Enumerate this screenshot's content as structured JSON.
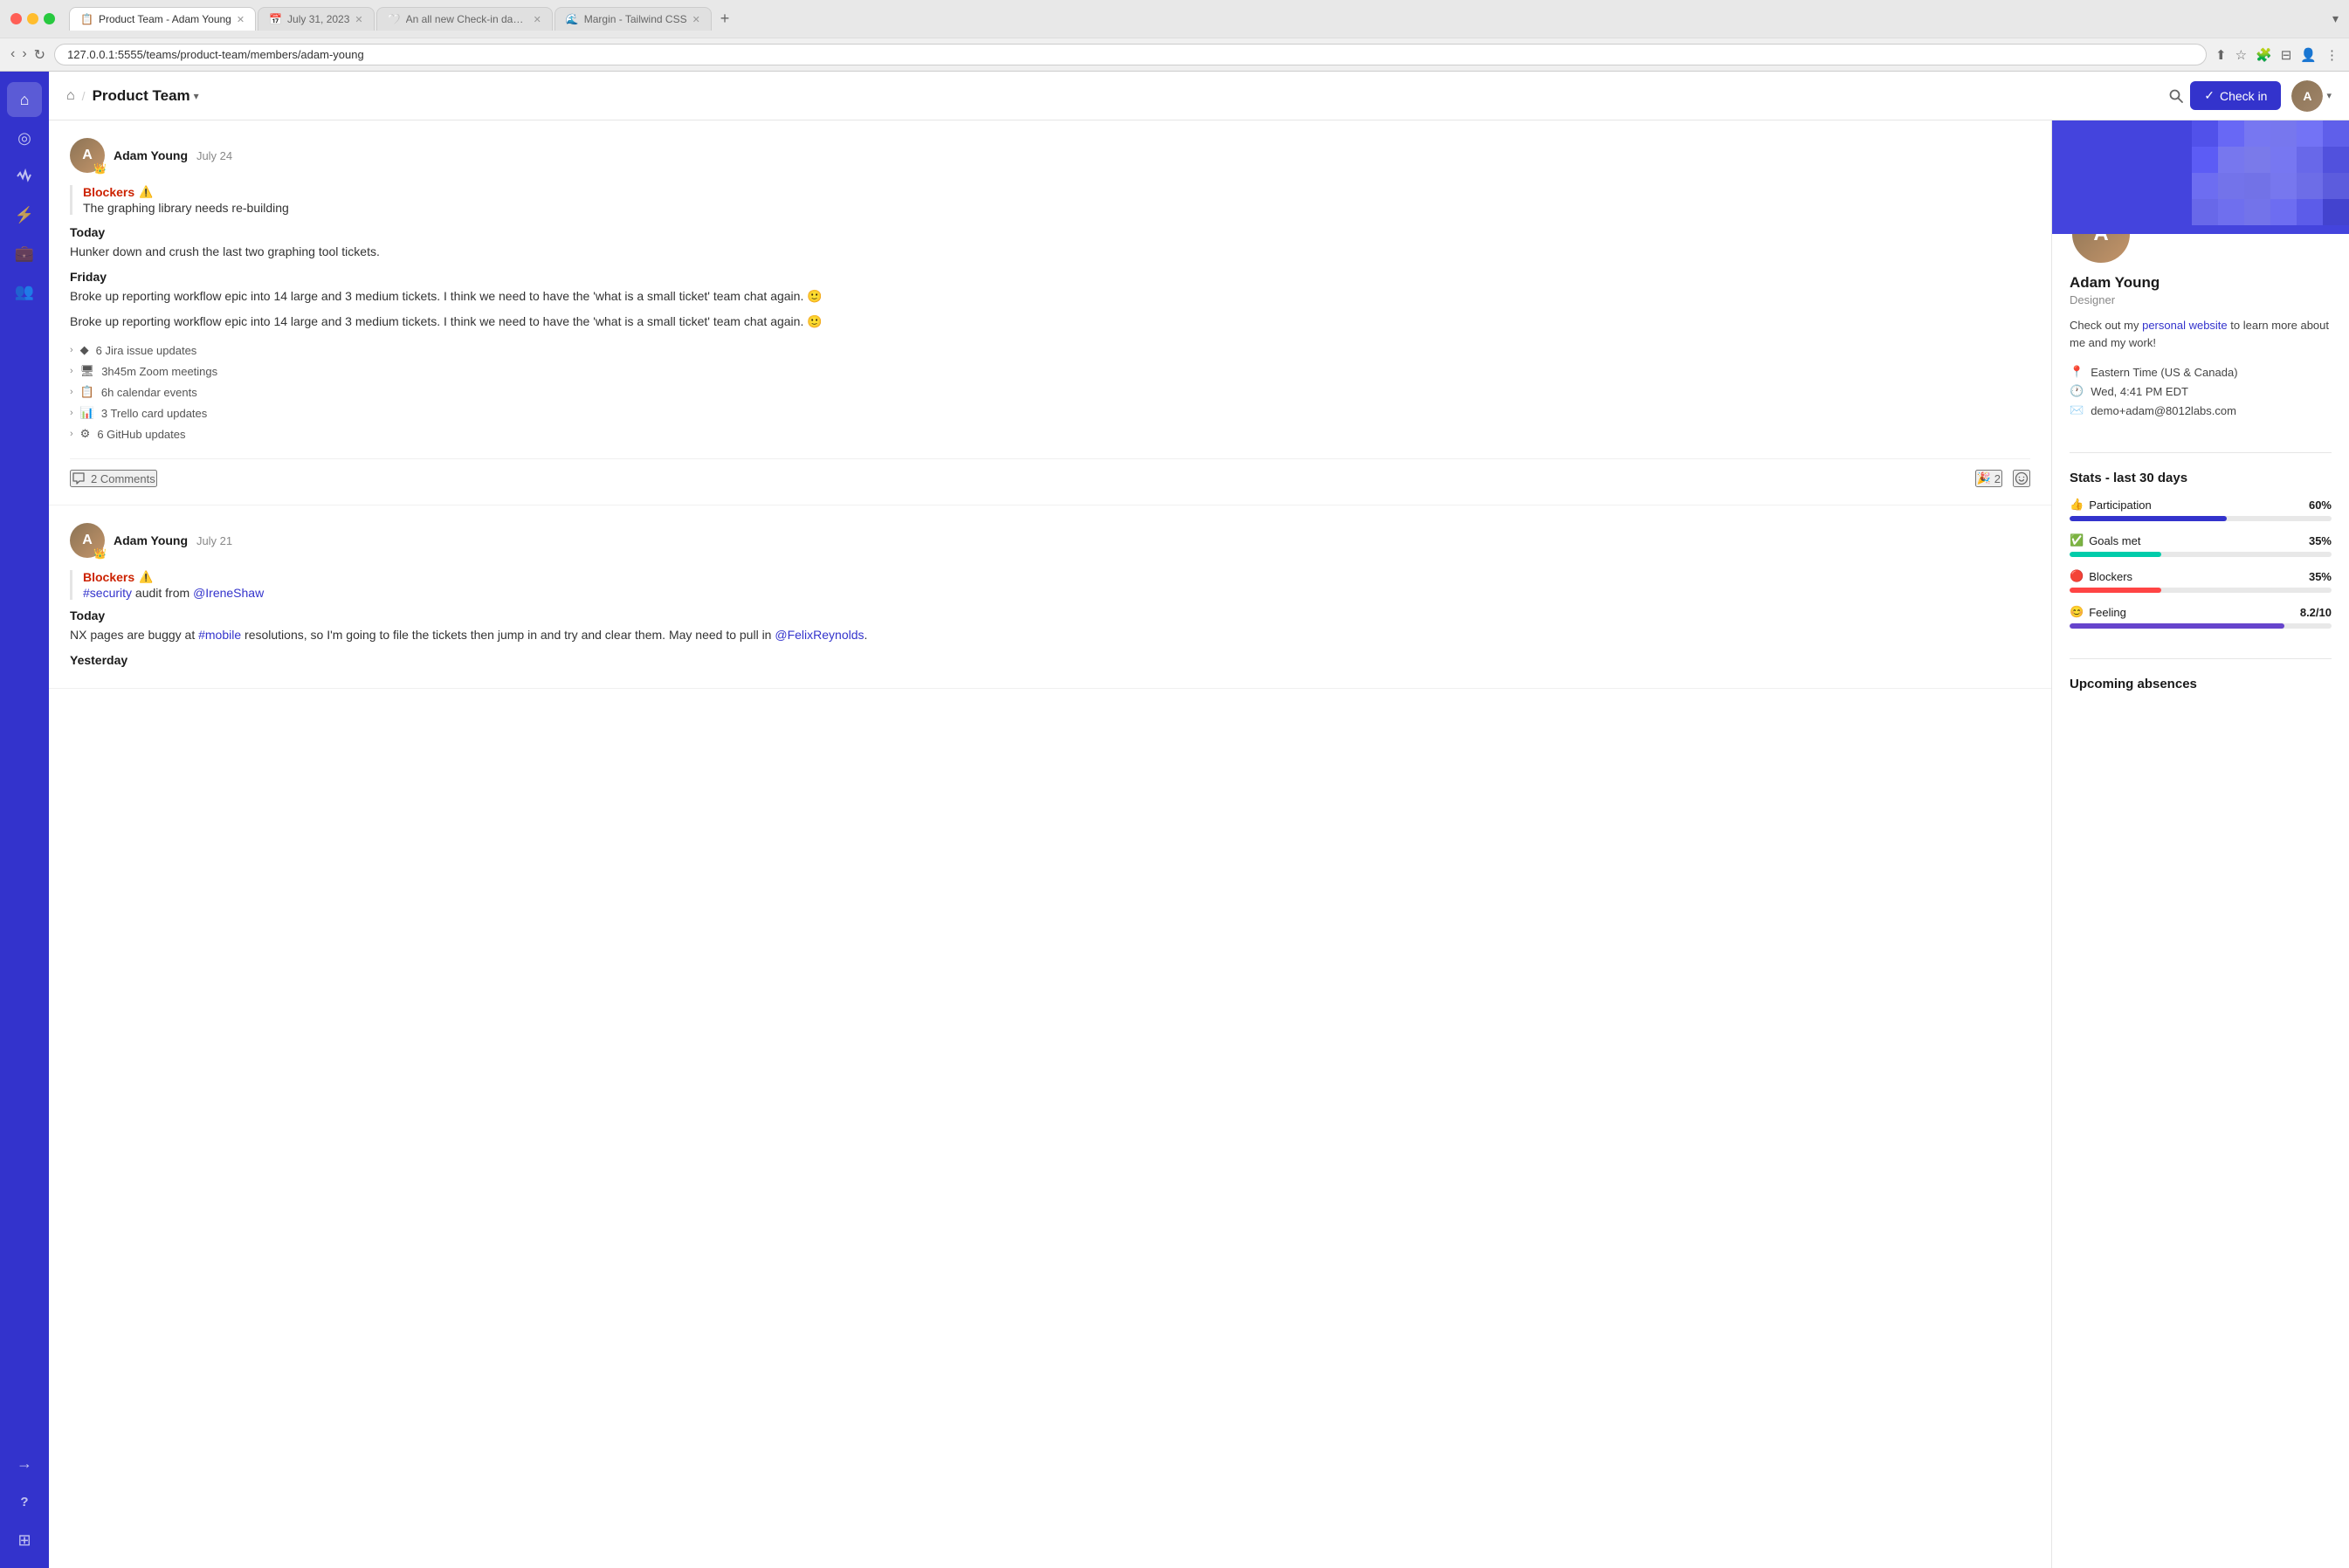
{
  "browser": {
    "url": "127.0.0.1:5555/teams/product-team/members/adam-young",
    "tabs": [
      {
        "label": "Product Team - Adam Young",
        "active": true,
        "favicon": "📋"
      },
      {
        "label": "July 31, 2023",
        "active": false,
        "favicon": "📅"
      },
      {
        "label": "An all new Check-in dashboar...",
        "active": false,
        "favicon": "🤍"
      },
      {
        "label": "Margin - Tailwind CSS",
        "active": false,
        "favicon": "🌊"
      }
    ]
  },
  "header": {
    "home_icon": "⌂",
    "team_name": "Product Team",
    "search_icon": "🔍",
    "check_in_label": "Check in",
    "check_in_icon": "✓"
  },
  "sidebar": {
    "icons": [
      {
        "name": "home",
        "symbol": "⌂",
        "active": true
      },
      {
        "name": "target",
        "symbol": "◎",
        "active": false
      },
      {
        "name": "activity",
        "symbol": "~",
        "active": false
      },
      {
        "name": "lightning",
        "symbol": "⚡",
        "active": false
      },
      {
        "name": "bag",
        "symbol": "👜",
        "active": false
      },
      {
        "name": "users",
        "symbol": "👥",
        "active": false
      }
    ],
    "bottom_icons": [
      {
        "name": "arrow-right",
        "symbol": "→"
      },
      {
        "name": "question",
        "symbol": "?"
      },
      {
        "name": "grid",
        "symbol": "⊞"
      }
    ]
  },
  "feed": {
    "items": [
      {
        "id": "item1",
        "author": "Adam Young",
        "date": "July 24",
        "avatar_emoji": "👑",
        "sections": {
          "blockers_label": "Blockers",
          "blockers_text": "The graphing library needs re-building",
          "today_label": "Today",
          "today_text": "Hunker down and crush the last two graphing tool tickets.",
          "friday_label": "Friday",
          "friday_text1": "Broke up reporting workflow epic into 14 large and 3 medium tickets. I think we need to have the 'what is a small ticket' team chat again. 🙂",
          "friday_text2": "Broke up reporting workflow epic into 14 large and 3 medium tickets. I think we need to have the 'what is a small ticket' team chat again. 🙂"
        },
        "activities": [
          {
            "icon": "◆",
            "text": "6 Jira issue updates"
          },
          {
            "icon": "🖥",
            "text": "3h45m Zoom meetings"
          },
          {
            "icon": "📋",
            "text": "6h calendar events"
          },
          {
            "icon": "📊",
            "text": "3 Trello card updates"
          },
          {
            "icon": "⚙",
            "text": "6 GitHub updates"
          }
        ],
        "comments_count": "2 Comments",
        "reactions": [
          {
            "emoji": "🎉",
            "count": "2"
          }
        ]
      },
      {
        "id": "item2",
        "author": "Adam Young",
        "date": "July 21",
        "avatar_emoji": "👑",
        "sections": {
          "blockers_label": "Blockers",
          "blockers_hashtag": "#security",
          "blockers_text": " audit from ",
          "blockers_mention": "@IreneShaw",
          "today_label": "Today",
          "today_text_pre": "NX pages are buggy at ",
          "today_hashtag": "#mobile",
          "today_text_mid": " resolutions, so I'm going to file the tickets then jump in and try and clear them. May need to pull in ",
          "today_mention": "@FelixReynolds",
          "today_text_end": ".",
          "yesterday_label": "Yesterday"
        }
      }
    ]
  },
  "profile": {
    "name": "Adam Young",
    "role": "Designer",
    "bio_pre": "Check out my ",
    "bio_link_text": "personal website",
    "bio_post": " to learn more about me and my work!",
    "timezone": "Eastern Time (US & Canada)",
    "local_time": "Wed, 4:41 PM EDT",
    "email": "demo+adam@8012labs.com"
  },
  "stats": {
    "title": "Stats - last 30 days",
    "items": [
      {
        "label": "Participation",
        "icon": "👍",
        "value": "60%",
        "fill": 60,
        "color": "blue"
      },
      {
        "label": "Goals met",
        "icon": "✅",
        "value": "35%",
        "fill": 35,
        "color": "teal"
      },
      {
        "label": "Blockers",
        "icon": "🔴",
        "value": "35%",
        "fill": 35,
        "color": "red"
      },
      {
        "label": "Feeling",
        "icon": "😊",
        "value": "8.2/10",
        "fill": 82,
        "color": "purple"
      }
    ]
  },
  "absences": {
    "title": "Upcoming absences"
  }
}
